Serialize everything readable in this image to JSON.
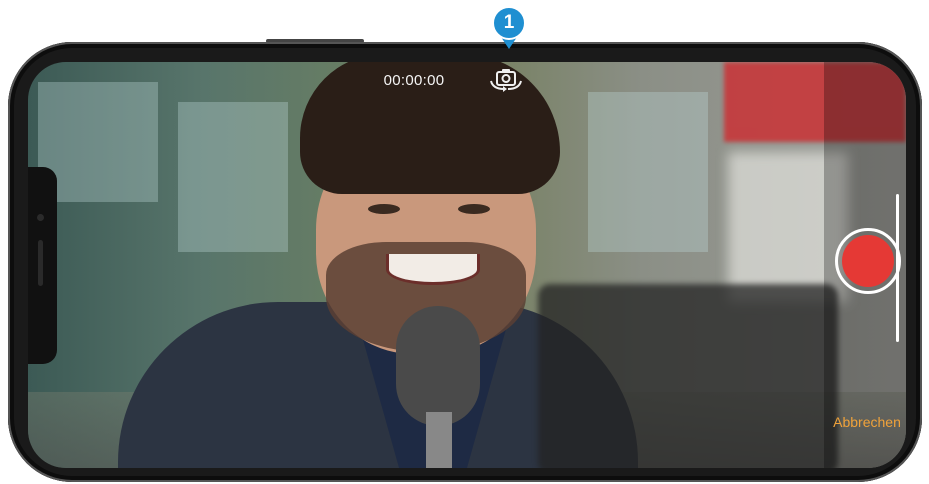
{
  "camera": {
    "timer": "00:00:00",
    "flip_icon": "camera-flip-icon",
    "record_icon": "record-icon",
    "cancel_label": "Abbrechen"
  },
  "callout": {
    "number": "1"
  },
  "colors": {
    "record": "#e53935",
    "cancel_text": "#f0a23a",
    "callout": "#1f8fd1"
  }
}
